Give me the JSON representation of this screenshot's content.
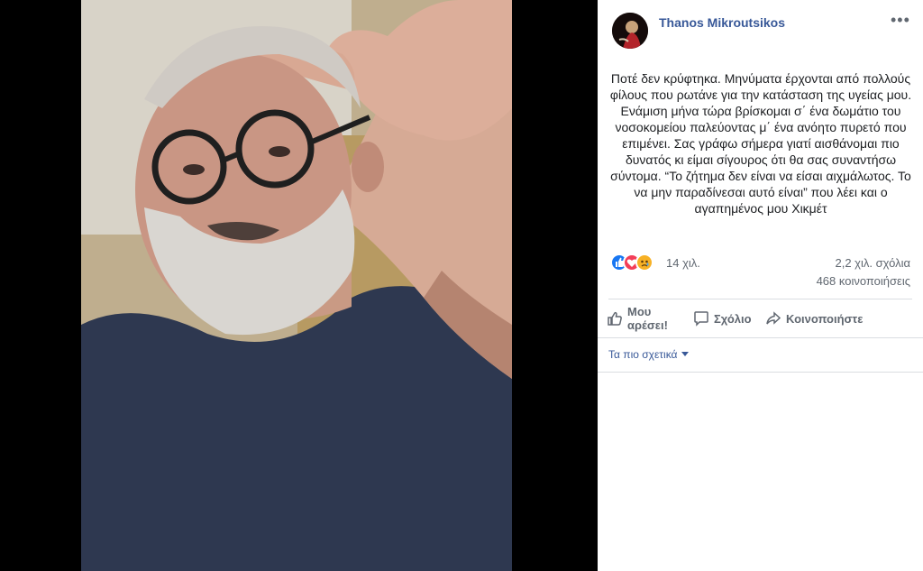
{
  "post": {
    "author": "Thanos Mikroutsikos",
    "text": "Ποτέ δεν κρύφτηκα. Μηνύματα έρχονται από πολλούς φίλους που ρωτάνε για την κατάσταση της υγείας μου. Ενάμιση μήνα τώρα βρίσκομαι σ΄ ένα δωμάτιο του νοσοκομείου παλεύοντας μ΄ ένα ανόητο πυρετό που επιμένει. Σας γράφω σήμερα γιατί αισθάνομαι πιο δυνατός κι είμαι σίγουρος ότι θα σας συναντήσω σύντομα. “Το ζήτημα δεν είναι να είσαι αιχμάλωτος. Το να μην παραδίνεσαι αυτό είναι” που λέει και ο αγαπημένος μου Χικμέτ",
    "reactions_count": "14 χιλ.",
    "comments_count": "2,2 χιλ. σχόλια",
    "shares_count": "468 κοινοποιήσεις"
  },
  "actions": {
    "like": "Μου αρέσει!",
    "comment": "Σχόλιο",
    "share": "Κοινοποιήστε"
  },
  "sort": {
    "label": "Τα πιο σχετικά"
  },
  "icons": {
    "reactions": [
      "like-icon",
      "love-icon",
      "sad-icon"
    ],
    "more": "more-options-icon"
  },
  "colors": {
    "link": "#385898",
    "like": "#1877f2",
    "love": "#f33e58",
    "sad": "#f7b125"
  }
}
